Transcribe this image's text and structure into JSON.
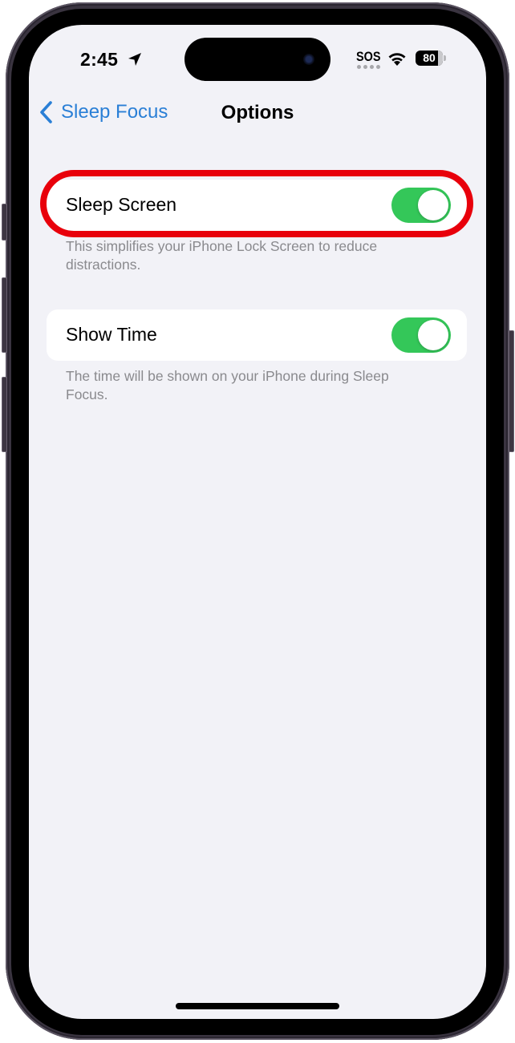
{
  "status_bar": {
    "time": "2:45",
    "location_icon": "location-arrow-icon",
    "carrier": "SOS",
    "wifi_icon": "wifi-icon",
    "battery_percent": "80"
  },
  "nav": {
    "back_label": "Sleep Focus",
    "back_icon": "chevron-left-icon",
    "title": "Options"
  },
  "settings": [
    {
      "label": "Sleep Screen",
      "enabled": true,
      "footnote": "This simplifies your iPhone Lock Screen to reduce distractions.",
      "highlighted": true
    },
    {
      "label": "Show Time",
      "enabled": true,
      "footnote": "The time will be shown on your iPhone during Sleep Focus.",
      "highlighted": false
    }
  ],
  "colors": {
    "accent": "#2a7fd6",
    "toggle_on": "#34c759",
    "highlight": "#e8000b",
    "background": "#f2f2f7"
  }
}
